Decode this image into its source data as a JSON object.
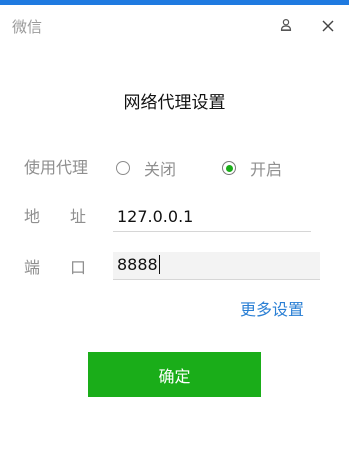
{
  "window": {
    "app_title": "微信",
    "accent_color": "#1f7ae0"
  },
  "titlebar_icons": {
    "user": "user-icon",
    "close": "close-icon"
  },
  "dialog": {
    "title": "网络代理设置"
  },
  "proxy": {
    "label": "使用代理",
    "options": [
      {
        "label": "关闭",
        "selected": false
      },
      {
        "label": "开启",
        "selected": true
      }
    ]
  },
  "address": {
    "label": "地址",
    "value": "127.0.0.1"
  },
  "port": {
    "label": "端口",
    "value": "8888"
  },
  "more_settings_label": "更多设置",
  "confirm_label": "确定",
  "colors": {
    "primary_green": "#1aad19",
    "link_blue": "#2a7fd4"
  }
}
